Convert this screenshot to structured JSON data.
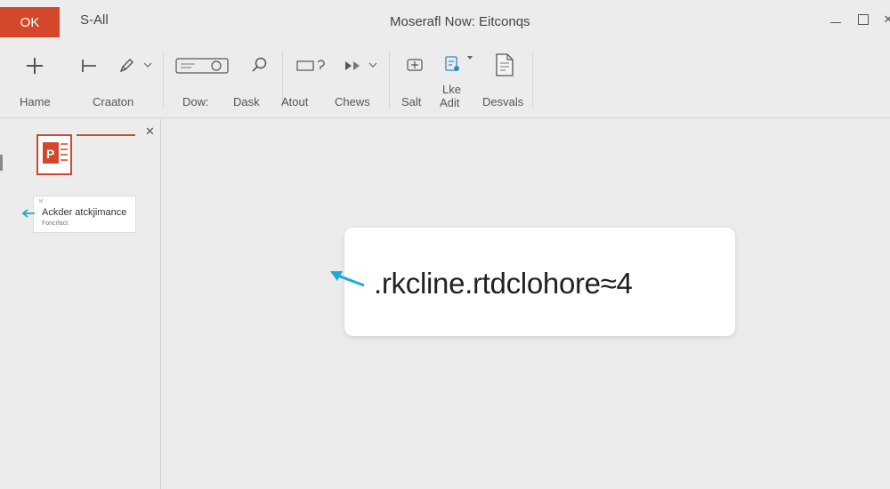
{
  "titlebar": {
    "ok_label": "OK",
    "tab_label": "S-All",
    "window_title": "Moserafl Now: Eitconqs"
  },
  "ribbon": {
    "labels": {
      "home": "Hame",
      "creation": "Craaton",
      "dow": "Dow:",
      "dask": "Dask",
      "about": "Atout",
      "chews": "Chews",
      "salt": "Salt",
      "like": "Lke",
      "adit": "Adit",
      "desvals": "Desvals"
    },
    "icons": [
      "plus-icon",
      "insert-line-icon",
      "pen-icon",
      "chevron-down-icon",
      "text-box-icon",
      "search-icon",
      "shape-icon",
      "media-icon",
      "chevron-down-icon",
      "share-icon",
      "format-icon",
      "chevron-down-icon",
      "document-icon"
    ]
  },
  "left_panel": {
    "close_icon": "close-icon",
    "file_icon": "powerpoint-icon",
    "file_tag": "P",
    "thumbnail": {
      "tiny_label": "M",
      "title": "Ackder atckjimance",
      "subtitle": "Foncrfact"
    }
  },
  "callout": {
    "text": ".rkcline.rtdclohore≈4"
  },
  "colors": {
    "accent": "#d4472b",
    "arrow": "#1ea8d8",
    "background": "#ebebeb"
  }
}
